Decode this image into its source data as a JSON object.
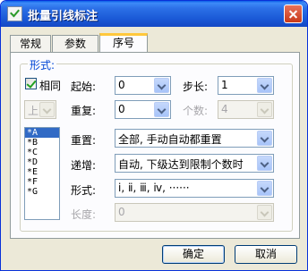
{
  "window": {
    "title": "批量引线标注"
  },
  "tabs": [
    {
      "label": "常规"
    },
    {
      "label": "参数"
    },
    {
      "label": "序号",
      "selected": true
    }
  ],
  "group": {
    "title": "形式:"
  },
  "same": {
    "label": "相同",
    "checked": true
  },
  "direction": {
    "value": "上"
  },
  "start": {
    "label": "起始:",
    "value": "0"
  },
  "step": {
    "label": "步长:",
    "value": "1"
  },
  "repeat": {
    "label": "重复:",
    "value": "0"
  },
  "count": {
    "label": "个数:",
    "value": "4"
  },
  "reset": {
    "label": "重置:",
    "value": "全部, 手动自动都重置"
  },
  "increment": {
    "label": "递增:",
    "value": "自动, 下级达到限制个数时"
  },
  "form": {
    "label": "形式:",
    "value": "ⅰ, ⅱ, ⅲ, ⅳ, ······"
  },
  "length": {
    "label": "长度:",
    "value": "0"
  },
  "preview_list": [
    "*A",
    "*B",
    "*C",
    "*D",
    "*E",
    "*F",
    "*G"
  ],
  "buttons": {
    "ok": "确定",
    "cancel": "取消"
  },
  "colors": {
    "titlebar": "#1a58d6",
    "group_title": "#0046d5",
    "selection": "#316ac5"
  }
}
